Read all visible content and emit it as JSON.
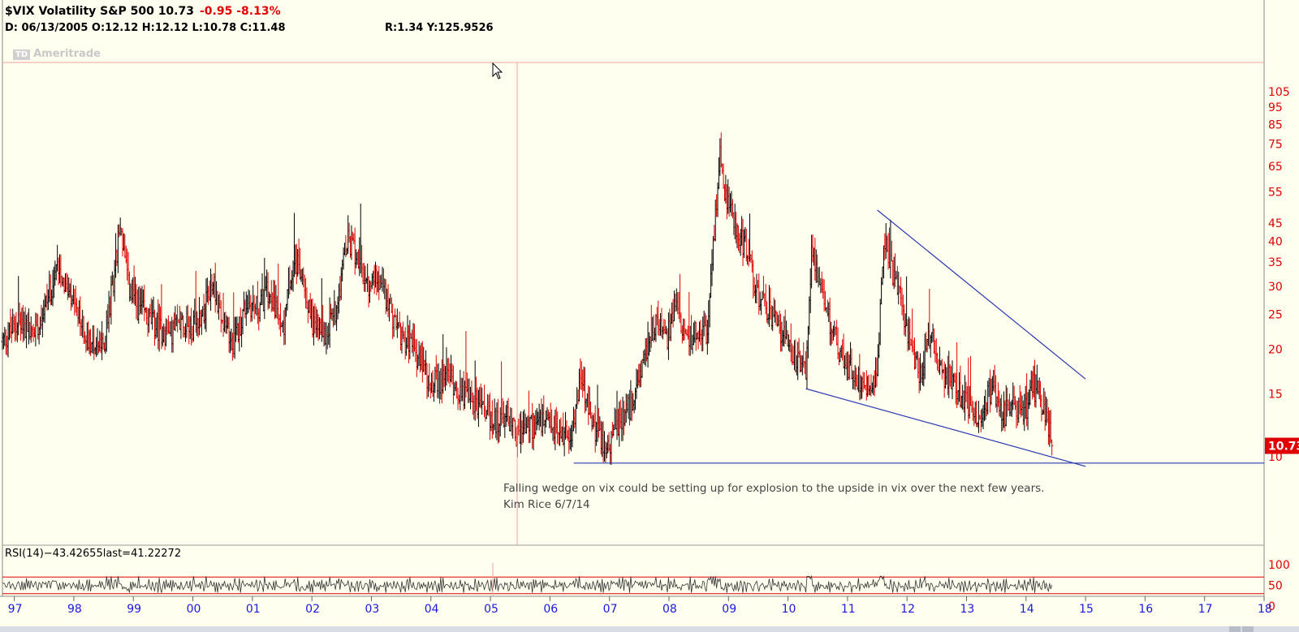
{
  "header": {
    "symbol_title": "$VIX Volatility S&P 500  10.73",
    "change": "-0.95  -8.13%",
    "ohlc": "D:  06/13/2005  O:12.12  H:12.12  L:10.78  C:11.48",
    "ry": "R:1.34     Y:125.9526"
  },
  "watermark": {
    "logo": "TD",
    "text": "Ameritrade"
  },
  "annotation": {
    "line1": "Falling wedge on vix could be setting up for explosion to the upside in vix over the next few years.",
    "line2": "Kim Rice 6/7/14"
  },
  "rsi_label": "RSI(14)−43.42655last=41.22272",
  "colors": {
    "up": "#000000",
    "down": "#e00000",
    "trendline": "#2a3ab0",
    "axis_text": "#e00000",
    "year_text": "#1a1adf",
    "crosshair": "#f0a0a0"
  },
  "chart_data": [
    {
      "type": "ohlc",
      "x_axis": {
        "labels": [
          "97",
          "98",
          "99",
          "00",
          "01",
          "02",
          "03",
          "04",
          "05",
          "06",
          "07",
          "08",
          "09",
          "10",
          "11",
          "12",
          "13",
          "14",
          "15",
          "16",
          "17",
          "18"
        ],
        "range": [
          1996.8,
          2018.0
        ]
      },
      "y_axis": {
        "scale": "log",
        "ticks": [
          10,
          15,
          20,
          25,
          30,
          35,
          40,
          45,
          55,
          65,
          75,
          85,
          95,
          105
        ],
        "range": [
          10,
          105
        ]
      },
      "last_price": {
        "value": "10.73",
        "numeric": 10.73
      },
      "weekly_closes": [
        {
          "year": 1996.8,
          "value": 21
        },
        {
          "year": 1997.1,
          "value": 24
        },
        {
          "year": 1997.3,
          "value": 22
        },
        {
          "year": 1997.5,
          "value": 26
        },
        {
          "year": 1997.75,
          "value": 35
        },
        {
          "year": 1997.9,
          "value": 28
        },
        {
          "year": 1998.1,
          "value": 24
        },
        {
          "year": 1998.3,
          "value": 21
        },
        {
          "year": 1998.5,
          "value": 20
        },
        {
          "year": 1998.65,
          "value": 30
        },
        {
          "year": 1998.78,
          "value": 45
        },
        {
          "year": 1998.9,
          "value": 31
        },
        {
          "year": 1999.0,
          "value": 27
        },
        {
          "year": 1999.2,
          "value": 25
        },
        {
          "year": 1999.4,
          "value": 23
        },
        {
          "year": 1999.6,
          "value": 22
        },
        {
          "year": 1999.8,
          "value": 24
        },
        {
          "year": 2000.0,
          "value": 23
        },
        {
          "year": 2000.2,
          "value": 26
        },
        {
          "year": 2000.35,
          "value": 31
        },
        {
          "year": 2000.5,
          "value": 23
        },
        {
          "year": 2000.7,
          "value": 21
        },
        {
          "year": 2000.9,
          "value": 27
        },
        {
          "year": 2001.1,
          "value": 26
        },
        {
          "year": 2001.3,
          "value": 30
        },
        {
          "year": 2001.5,
          "value": 22
        },
        {
          "year": 2001.7,
          "value": 36
        },
        {
          "year": 2001.85,
          "value": 31
        },
        {
          "year": 2002.0,
          "value": 24
        },
        {
          "year": 2002.2,
          "value": 22
        },
        {
          "year": 2002.4,
          "value": 26
        },
        {
          "year": 2002.6,
          "value": 40
        },
        {
          "year": 2002.8,
          "value": 36
        },
        {
          "year": 2002.95,
          "value": 29
        },
        {
          "year": 2003.1,
          "value": 33
        },
        {
          "year": 2003.3,
          "value": 26
        },
        {
          "year": 2003.5,
          "value": 22
        },
        {
          "year": 2003.7,
          "value": 20
        },
        {
          "year": 2003.9,
          "value": 17
        },
        {
          "year": 2004.1,
          "value": 16
        },
        {
          "year": 2004.3,
          "value": 17
        },
        {
          "year": 2004.5,
          "value": 15
        },
        {
          "year": 2004.7,
          "value": 14.5
        },
        {
          "year": 2004.9,
          "value": 13.5
        },
        {
          "year": 2005.1,
          "value": 12.5
        },
        {
          "year": 2005.3,
          "value": 13
        },
        {
          "year": 2005.45,
          "value": 11.5
        },
        {
          "year": 2005.6,
          "value": 12
        },
        {
          "year": 2005.8,
          "value": 12.5
        },
        {
          "year": 2006.0,
          "value": 12
        },
        {
          "year": 2006.2,
          "value": 11.5
        },
        {
          "year": 2006.4,
          "value": 12
        },
        {
          "year": 2006.5,
          "value": 17
        },
        {
          "year": 2006.7,
          "value": 12.5
        },
        {
          "year": 2006.9,
          "value": 11
        },
        {
          "year": 2007.0,
          "value": 10.5
        },
        {
          "year": 2007.2,
          "value": 13
        },
        {
          "year": 2007.4,
          "value": 14
        },
        {
          "year": 2007.6,
          "value": 20
        },
        {
          "year": 2007.8,
          "value": 24
        },
        {
          "year": 2007.95,
          "value": 21
        },
        {
          "year": 2008.1,
          "value": 26
        },
        {
          "year": 2008.3,
          "value": 21
        },
        {
          "year": 2008.5,
          "value": 23
        },
        {
          "year": 2008.65,
          "value": 22
        },
        {
          "year": 2008.75,
          "value": 40
        },
        {
          "year": 2008.85,
          "value": 70
        },
        {
          "year": 2008.95,
          "value": 55
        },
        {
          "year": 2009.1,
          "value": 45
        },
        {
          "year": 2009.3,
          "value": 38
        },
        {
          "year": 2009.5,
          "value": 28
        },
        {
          "year": 2009.7,
          "value": 25
        },
        {
          "year": 2009.9,
          "value": 22
        },
        {
          "year": 2010.1,
          "value": 19
        },
        {
          "year": 2010.3,
          "value": 17
        },
        {
          "year": 2010.4,
          "value": 40
        },
        {
          "year": 2010.5,
          "value": 30
        },
        {
          "year": 2010.7,
          "value": 24
        },
        {
          "year": 2010.9,
          "value": 19
        },
        {
          "year": 2011.1,
          "value": 17
        },
        {
          "year": 2011.3,
          "value": 16
        },
        {
          "year": 2011.5,
          "value": 17
        },
        {
          "year": 2011.6,
          "value": 40
        },
        {
          "year": 2011.7,
          "value": 35
        },
        {
          "year": 2011.85,
          "value": 30
        },
        {
          "year": 2012.0,
          "value": 22
        },
        {
          "year": 2012.2,
          "value": 17
        },
        {
          "year": 2012.4,
          "value": 22
        },
        {
          "year": 2012.6,
          "value": 17
        },
        {
          "year": 2012.8,
          "value": 16
        },
        {
          "year": 2013.0,
          "value": 14
        },
        {
          "year": 2013.2,
          "value": 13
        },
        {
          "year": 2013.45,
          "value": 16
        },
        {
          "year": 2013.6,
          "value": 13
        },
        {
          "year": 2013.8,
          "value": 14
        },
        {
          "year": 2014.0,
          "value": 13.5
        },
        {
          "year": 2014.1,
          "value": 16
        },
        {
          "year": 2014.2,
          "value": 15
        },
        {
          "year": 2014.35,
          "value": 13
        },
        {
          "year": 2014.45,
          "value": 10.73
        }
      ],
      "trendlines": [
        {
          "name": "wedge-upper",
          "from": {
            "year": 2011.5,
            "value": 49
          },
          "to": {
            "year": 2015.0,
            "value": 16.5
          }
        },
        {
          "name": "wedge-lower",
          "from": {
            "year": 2010.3,
            "value": 15.5
          },
          "to": {
            "year": 2015.0,
            "value": 9.4
          }
        },
        {
          "name": "horizontal-support",
          "from": {
            "year": 2006.4,
            "value": 9.6
          },
          "to": {
            "year": 2018.0,
            "value": 9.6
          }
        }
      ],
      "crosshair": {
        "year": 2005.45,
        "value": 125.9526
      }
    },
    {
      "type": "line",
      "name": "RSI(14)",
      "y_ticks": [
        0,
        50,
        100
      ],
      "y_range": [
        0,
        100
      ],
      "reference_levels": [
        30,
        70
      ],
      "last": 41.22
    }
  ]
}
